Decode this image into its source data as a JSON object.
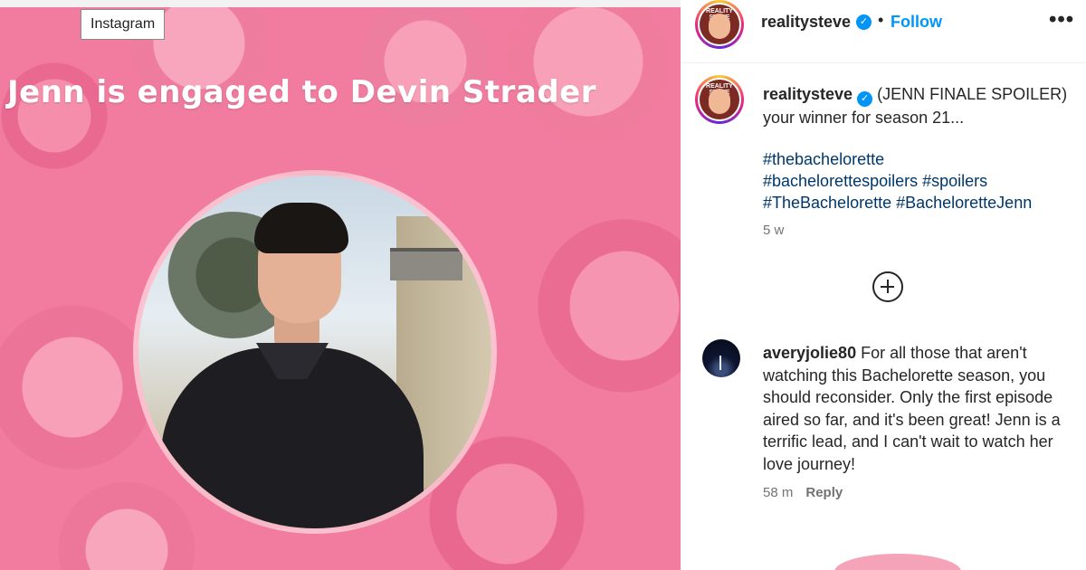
{
  "browser": {
    "tooltip": "Instagram"
  },
  "media": {
    "overlay_text": "Jenn is engaged to Devin Strader"
  },
  "header": {
    "username": "realitysteve",
    "separator": "•",
    "follow_label": "Follow",
    "more_label": "•••",
    "avatar_text": "REALITY STEVE"
  },
  "caption": {
    "username": "realitysteve",
    "text": "(JENN FINALE SPOILER) your winner for season 21...",
    "hashtags": [
      "#thebachelorette",
      "#bachelorettespoilers",
      "#spoilers",
      "#TheBachelorette",
      "#BacheloretteJenn"
    ],
    "timestamp": "5 w"
  },
  "comments": [
    {
      "username": "averyjolie80",
      "text": "For all those that aren't watching this Bachelorette season, you should reconsider. Only the first episode aired so far, and it's been great! Jenn is a terrific lead, and I can't wait to watch her love journey!",
      "time": "58 m",
      "reply_label": "Reply"
    }
  ],
  "icons": {
    "verified": "verified-badge-icon",
    "more": "more-options-icon",
    "load_more": "plus-circle-icon"
  },
  "colors": {
    "link": "#0095f6",
    "hashtag": "#00376b",
    "muted": "#737373",
    "text": "#262626"
  }
}
